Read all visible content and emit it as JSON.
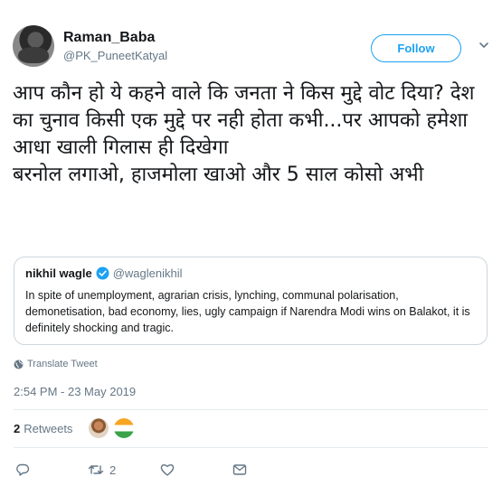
{
  "author": {
    "display_name": "Raman_Baba",
    "handle": "@PK_PuneetKatyal"
  },
  "follow_label": "Follow",
  "tweet": {
    "text": "आप कौन हो ये कहने वाले कि जनता ने किस मुद्दे वोट दिया? देश का चुनाव किसी एक मुद्दे पर नही होता कभी...पर आपको हमेशा आधा खाली गिलास ही दिखेगा\n बरनोल लगाओ, हाजमोला खाओ और 5 साल कोसो अभी"
  },
  "quoted_tweet": {
    "name": "nikhil wagle",
    "handle": "@waglenikhil",
    "text": "In spite of unemployment, agrarian crisis, lynching, communal polarisation, demonetisation, bad economy, lies, ugly campaign if Narendra Modi wins on Balakot, it is definitely shocking and tragic."
  },
  "translate_label": "Translate Tweet",
  "timestamp": "2:54 PM - 23 May 2019",
  "stats": {
    "retweet_count": "2",
    "retweet_label": "Retweets"
  },
  "actions": {
    "retweet_count": "2"
  },
  "icons": {
    "caret": "chevron-down-icon",
    "verified": "verified-badge-icon",
    "globe": "globe-icon",
    "reply": "reply-icon",
    "retweet": "retweet-icon",
    "like": "heart-icon",
    "dm": "envelope-icon"
  },
  "colors": {
    "accent": "#1da1f2",
    "muted": "#657786",
    "border": "#ccd6dd"
  }
}
